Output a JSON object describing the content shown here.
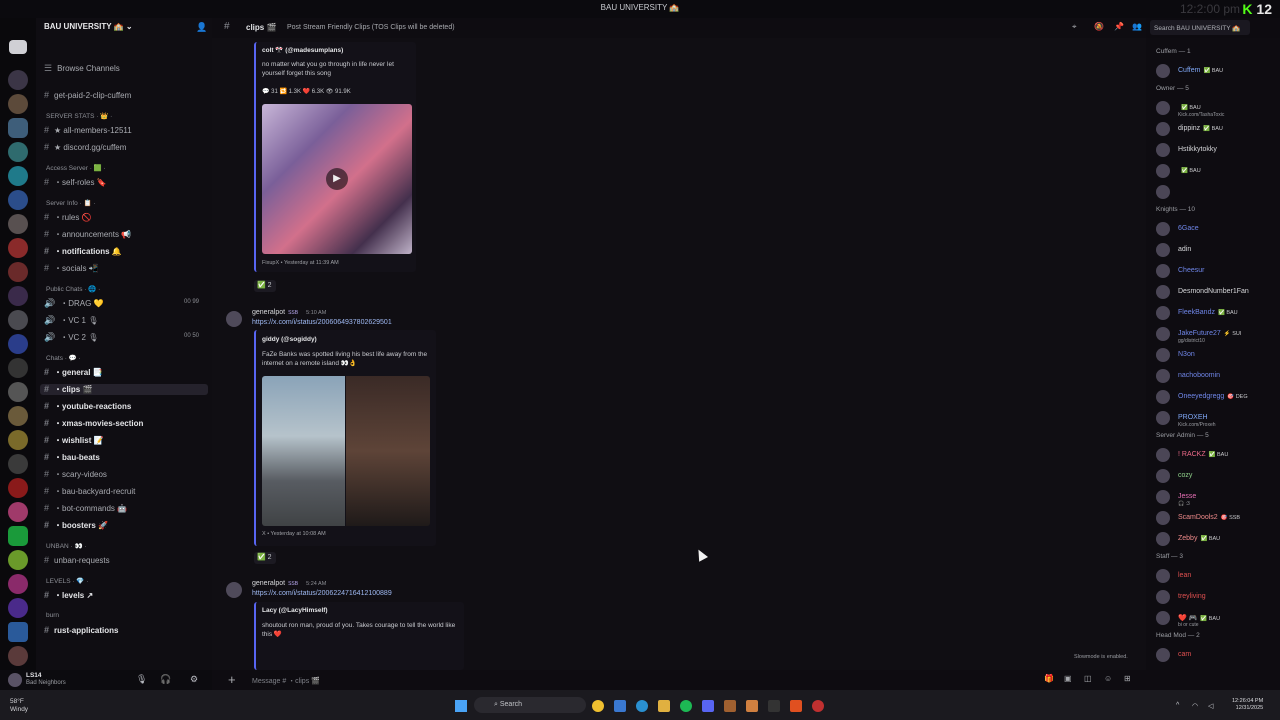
{
  "window": {
    "title": "BAU UNIVERSITY 🏫",
    "watermark_k": "K",
    "watermark_num": "12",
    "ghost_text": "12:2:00 pm"
  },
  "server": {
    "name": "BAU UNIVERSITY 🏫",
    "browse": "Browse Channels"
  },
  "channels": [
    {
      "type": "channel",
      "label": "get-paid-2-clip-cuffem"
    },
    {
      "type": "category",
      "label": "SERVER STATS · 👑 ·"
    },
    {
      "type": "channel",
      "label": "★ all-members-12511"
    },
    {
      "type": "channel",
      "label": "★ discord.gg/cuffem"
    },
    {
      "type": "category",
      "label": "Access Server · 🟩 ·"
    },
    {
      "type": "channel",
      "label": "・self-roles 🔖"
    },
    {
      "type": "category",
      "label": "Server Info · 📋 ·"
    },
    {
      "type": "channel",
      "label": "・rules 🚫"
    },
    {
      "type": "channel",
      "label": "・announcements 📢"
    },
    {
      "type": "channel",
      "label": "・notifications 🔔",
      "bold": true
    },
    {
      "type": "channel",
      "label": "・socials 📲"
    },
    {
      "type": "category",
      "label": "Public Chats · 🌐 ·"
    },
    {
      "type": "voice",
      "label": "・DRAG 💛",
      "count": "00 99"
    },
    {
      "type": "voice",
      "label": "・VC 1 🎙"
    },
    {
      "type": "voice",
      "label": "・VC 2 🎙",
      "count": "00 50"
    },
    {
      "type": "category",
      "label": "Chats · 💬 ·"
    },
    {
      "type": "channel",
      "label": "・general 📑",
      "bold": true
    },
    {
      "type": "channel",
      "label": "・clips 🎬",
      "bold": true,
      "selected": true
    },
    {
      "type": "channel",
      "label": "・youtube-reactions",
      "bold": true
    },
    {
      "type": "channel",
      "label": "・xmas-movies-section",
      "bold": true
    },
    {
      "type": "channel",
      "label": "・wishlist 📝",
      "bold": true
    },
    {
      "type": "channel",
      "label": "・bau-beats",
      "bold": true
    },
    {
      "type": "channel",
      "label": "・scary-videos"
    },
    {
      "type": "channel",
      "label": "・bau-backyard-recruit"
    },
    {
      "type": "channel",
      "label": "・bot-commands 🤖"
    },
    {
      "type": "channel",
      "label": "・boosters 🚀",
      "bold": true
    },
    {
      "type": "category",
      "label": "UNBAN · 👀 ·"
    },
    {
      "type": "channel",
      "label": "unban-requests"
    },
    {
      "type": "category",
      "label": "LEVELS · 💎 ·"
    },
    {
      "type": "channel",
      "label": "・levels ↗",
      "bold": true
    },
    {
      "type": "category",
      "label": "burn"
    },
    {
      "type": "channel",
      "label": "rust-applications",
      "bold": true
    }
  ],
  "user": {
    "name": "LS14",
    "status": "Bad Neighbors"
  },
  "header": {
    "channel": "clips 🎬",
    "topic": "Post Stream Friendly Clips (TOS Clips will be deleted)",
    "search": "Search BAU UNIVERSITY 🏫"
  },
  "messages": {
    "embed1": {
      "author": "colt 🎌 (@madesumplans)",
      "text": "no matter what you go through in life never let yourself forget this song",
      "stats": "💬 31   🔁 1.3K   ❤️ 6.3K   👁 91.9K",
      "footer": "FixupX • Yesterday at 11:39 AM",
      "reaction": "✅ 2"
    },
    "msg2": {
      "name": "generalpot",
      "badge": "SSB",
      "time": "5:10 AM",
      "link": "https://x.com/i/status/2006064937802629501",
      "embed_author": "giddy (@sogiddy)",
      "embed_text": "FaZe Banks was spotted living his best life away from the internet on a remote island 👀👌",
      "footer": "X • Yesterday at 10:08 AM",
      "reaction": "✅ 2"
    },
    "msg3": {
      "name": "generalpot",
      "badge": "SSB",
      "time": "5:24 AM",
      "link": "https://x.com/i/status/2006224716412100889",
      "embed_author": "Lacy (@LacyHimself)",
      "embed_text": "shoutout ron man, proud of you. Takes courage to tell the world like this ❤️"
    },
    "slowmode": "Slowmode is enabled."
  },
  "input": {
    "placeholder": "Message # ・clips 🎬"
  },
  "members": [
    {
      "kind": "head",
      "label": "Cuffem — 1"
    },
    {
      "kind": "member",
      "name": "Cuffem",
      "tag": "✅ BAU",
      "color": "#7fa7f5"
    },
    {
      "kind": "head",
      "label": "Owner — 5"
    },
    {
      "kind": "member",
      "name": "",
      "tag": "✅ BAU",
      "sub": "Kick.com/TashaToxic",
      "color": "#c9a3f0"
    },
    {
      "kind": "member",
      "name": "dippinz",
      "tag": "✅ BAU",
      "color": "#d6d7da"
    },
    {
      "kind": "member",
      "name": "Hstikkytokky",
      "tag": "",
      "color": "#d6d7da"
    },
    {
      "kind": "member",
      "name": "",
      "tag": "✅ BAU",
      "color": "#d6d7da"
    },
    {
      "kind": "member",
      "name": "",
      "tag": "",
      "color": "#d6d7da"
    },
    {
      "kind": "head",
      "label": "Knights — 10"
    },
    {
      "kind": "member",
      "name": "6Gace",
      "tag": "",
      "color": "#6f86e8"
    },
    {
      "kind": "member",
      "name": "adin",
      "tag": "",
      "color": "#d6d7da"
    },
    {
      "kind": "member",
      "name": "Cheesur",
      "tag": "",
      "color": "#6f86e8"
    },
    {
      "kind": "member",
      "name": "DesmondNumber1Fan",
      "tag": "",
      "color": "#d6d7da"
    },
    {
      "kind": "member",
      "name": "FleekBandz",
      "tag": "✅ BAU",
      "color": "#6f86e8"
    },
    {
      "kind": "member",
      "name": "JakeFuture27",
      "tag": "⚡ SUI",
      "sub": "gg/district10",
      "color": "#6f86e8"
    },
    {
      "kind": "member",
      "name": "N3on",
      "tag": "",
      "color": "#6f86e8"
    },
    {
      "kind": "member",
      "name": "nachoboomin",
      "tag": "",
      "color": "#6f86e8"
    },
    {
      "kind": "member",
      "name": "Oneeyedgregg",
      "tag": "🎯 DEG",
      "color": "#6f86e8"
    },
    {
      "kind": "member",
      "name": "PROXEH",
      "tag": "",
      "sub": "Kick.com/Proxeh",
      "color": "#7fa7f5"
    },
    {
      "kind": "head",
      "label": "Server Admin — 5"
    },
    {
      "kind": "member",
      "name": "! RACKZ",
      "tag": "✅ BAU",
      "color": "#ef6b8a"
    },
    {
      "kind": "member",
      "name": "cozy",
      "tag": "",
      "color": "#8fd18a"
    },
    {
      "kind": "member",
      "name": "Jesse",
      "tag": "",
      "sub": "🎧 :3",
      "color": "#e76fb5"
    },
    {
      "kind": "member",
      "name": "ScamDools2",
      "tag": "🎯 SSB",
      "color": "#ef8a8a"
    },
    {
      "kind": "member",
      "name": "Zebby",
      "tag": "✅ BAU",
      "color": "#ef8a8a"
    },
    {
      "kind": "head",
      "label": "Staff — 3"
    },
    {
      "kind": "member",
      "name": "lean",
      "tag": "",
      "color": "#e05050"
    },
    {
      "kind": "member",
      "name": "treyliving",
      "tag": "",
      "color": "#e05050"
    },
    {
      "kind": "member",
      "name": "❤️ 🎮",
      "tag": "✅ BAU",
      "sub": "bi or cute",
      "color": "#e05050"
    },
    {
      "kind": "head",
      "label": "Head Mod — 2"
    },
    {
      "kind": "member",
      "name": "cam",
      "tag": "",
      "color": "#e05050"
    }
  ],
  "taskbar": {
    "temp": "58°F",
    "cond": "Windy",
    "search": "Search",
    "time": "12:26:04 PM",
    "date": "12/31/2025"
  }
}
